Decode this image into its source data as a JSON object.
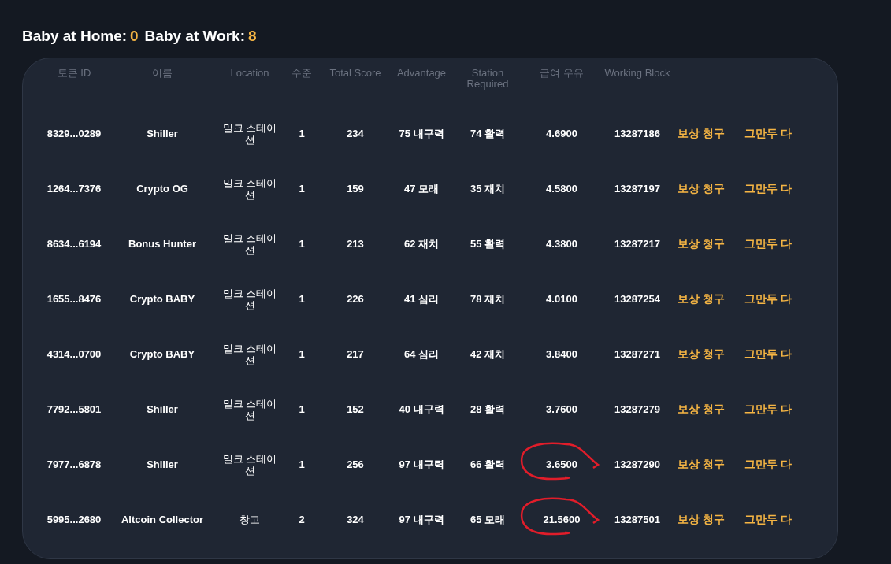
{
  "summary": [
    {
      "label": "Baby at Home:",
      "value": "0"
    },
    {
      "label": "Baby at Work:",
      "value": "8"
    }
  ],
  "table": {
    "columns": [
      "토큰 ID",
      "이름",
      "Location",
      "수준",
      "Total Score",
      "Advantage",
      "Station Required",
      "급여 우유",
      "Working Block"
    ],
    "rows": [
      {
        "token_id": "8329...0289",
        "name": "Shiller",
        "location": "밀크 스테이션",
        "level": "1",
        "total_score": "234",
        "advantage": "75 내구력",
        "station_required": "74 활력",
        "pay": "4.6900",
        "working_block": "13287186",
        "claim": "보상 청구",
        "quit": "그만두 다",
        "circled": false
      },
      {
        "token_id": "1264...7376",
        "name": "Crypto OG",
        "location": "밀크 스테이션",
        "level": "1",
        "total_score": "159",
        "advantage": "47 모래",
        "station_required": "35 재치",
        "pay": "4.5800",
        "working_block": "13287197",
        "claim": "보상 청구",
        "quit": "그만두 다",
        "circled": false
      },
      {
        "token_id": "8634...6194",
        "name": "Bonus Hunter",
        "location": "밀크 스테이션",
        "level": "1",
        "total_score": "213",
        "advantage": "62 재치",
        "station_required": "55 활력",
        "pay": "4.3800",
        "working_block": "13287217",
        "claim": "보상 청구",
        "quit": "그만두 다",
        "circled": false
      },
      {
        "token_id": "1655...8476",
        "name": "Crypto BABY",
        "location": "밀크 스테이션",
        "level": "1",
        "total_score": "226",
        "advantage": "41 심리",
        "station_required": "78 재치",
        "pay": "4.0100",
        "working_block": "13287254",
        "claim": "보상 청구",
        "quit": "그만두 다",
        "circled": false
      },
      {
        "token_id": "4314...0700",
        "name": "Crypto BABY",
        "location": "밀크 스테이션",
        "level": "1",
        "total_score": "217",
        "advantage": "64 심리",
        "station_required": "42 재치",
        "pay": "3.8400",
        "working_block": "13287271",
        "claim": "보상 청구",
        "quit": "그만두 다",
        "circled": false
      },
      {
        "token_id": "7792...5801",
        "name": "Shiller",
        "location": "밀크 스테이션",
        "level": "1",
        "total_score": "152",
        "advantage": "40 내구력",
        "station_required": "28 활력",
        "pay": "3.7600",
        "working_block": "13287279",
        "claim": "보상 청구",
        "quit": "그만두 다",
        "circled": false
      },
      {
        "token_id": "7977...6878",
        "name": "Shiller",
        "location": "밀크 스테이션",
        "level": "1",
        "total_score": "256",
        "advantage": "97 내구력",
        "station_required": "66 활력",
        "pay": "3.6500",
        "working_block": "13287290",
        "claim": "보상 청구",
        "quit": "그만두 다",
        "circled": true
      },
      {
        "token_id": "5995...2680",
        "name": "Altcoin Collector",
        "location": "창고",
        "level": "2",
        "total_score": "324",
        "advantage": "97 내구력",
        "station_required": "65 모래",
        "pay": "21.5600",
        "working_block": "13287501",
        "claim": "보상 청구",
        "quit": "그만두 다",
        "circled": true
      }
    ]
  }
}
